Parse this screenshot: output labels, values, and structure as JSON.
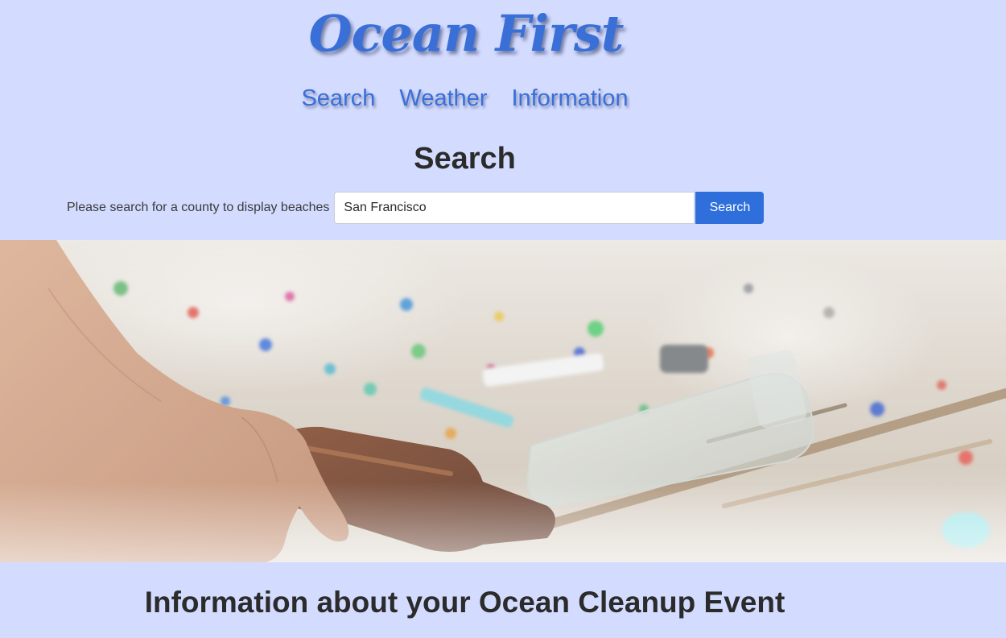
{
  "brand": {
    "logo_text": "Ocean First",
    "accent_color": "#3a6fd8",
    "background_color": "#d3dcff"
  },
  "nav": {
    "items": [
      {
        "label": "Search"
      },
      {
        "label": "Weather"
      },
      {
        "label": "Information"
      }
    ]
  },
  "search": {
    "heading": "Search",
    "prompt": "Please search for a county to display beaches",
    "input_value": "San Francisco",
    "button_label": "Search",
    "button_color": "#2f6fdc"
  },
  "hero": {
    "image_description_icon": "beach-litter-photo"
  },
  "info": {
    "heading": "Information about your Ocean Cleanup Event"
  }
}
